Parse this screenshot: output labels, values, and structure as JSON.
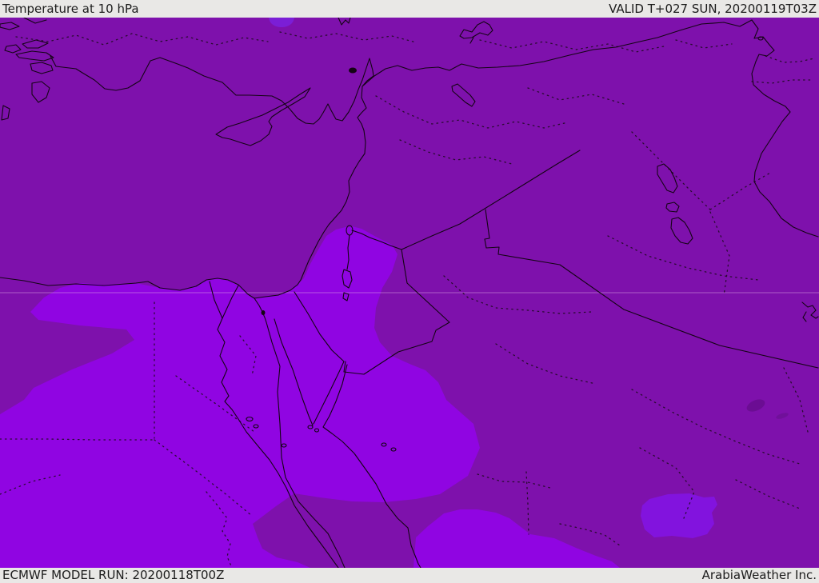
{
  "header": {
    "title": "Temperature at 10 hPa",
    "valid_label": "VALID T+027 SUN, 20200119T03Z"
  },
  "footer": {
    "model_run_label": "ECMWF MODEL RUN: 20200118T00Z",
    "provider_label": "ArabiaWeather Inc."
  },
  "map": {
    "palette": {
      "chrome_bg": "#E9E8E6",
      "chrome_text": "#1C1C1C",
      "base": "#7E11AC",
      "bright": "#9005E2",
      "blob_violet": "#8213DE",
      "blob_blue": "#7B1ED6",
      "spot_dark": "#6B0D93",
      "spot_dark2": "#70109A",
      "line": "#140414",
      "dotted": "#1B0B1B",
      "graticule": "#DFA9E6"
    }
  }
}
